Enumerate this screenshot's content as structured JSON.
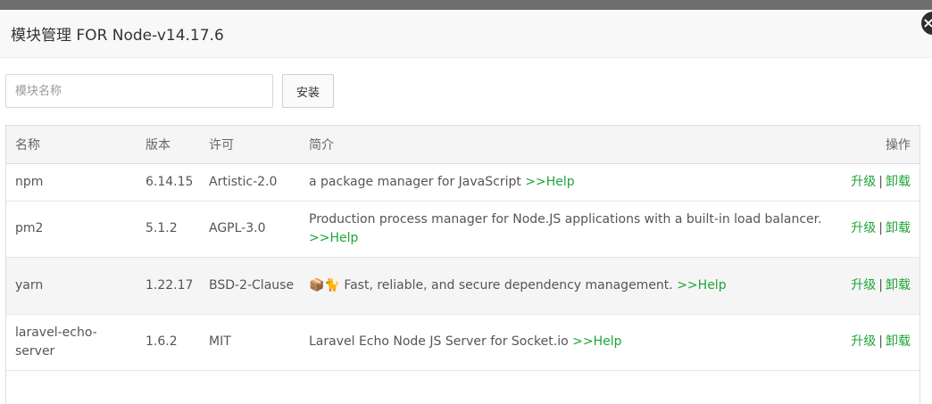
{
  "dialog": {
    "title": "模块管理 FOR Node-v14.17.6",
    "close_label": "×"
  },
  "toolbar": {
    "search_placeholder": "模块名称",
    "install_label": "安装"
  },
  "table": {
    "headers": [
      "名称",
      "版本",
      "许可",
      "简介",
      "操作"
    ],
    "rows": [
      {
        "name": "npm",
        "version": "6.14.15",
        "license": "Artistic-2.0",
        "desc": "a package manager for JavaScript",
        "help": ">>Help",
        "upgrade": "升级",
        "sep": "|",
        "uninstall": "卸载"
      },
      {
        "name": "pm2",
        "version": "5.1.2",
        "license": "AGPL-3.0",
        "desc": "Production process manager for Node.JS applications with a built-in load balancer.",
        "help": ">>Help",
        "upgrade": "升级",
        "sep": "|",
        "uninstall": "卸载"
      },
      {
        "name": "yarn",
        "version": "1.22.17",
        "license": "BSD-2-Clause",
        "desc": "📦🐈 Fast, reliable, and secure dependency management.",
        "help": ">>Help",
        "upgrade": "升级",
        "sep": "|",
        "uninstall": "卸载"
      },
      {
        "name": "laravel-echo-server",
        "version": "1.6.2",
        "license": "MIT",
        "desc": "Laravel Echo Node JS Server for Socket.io",
        "help": ">>Help",
        "upgrade": "升级",
        "sep": "|",
        "uninstall": "卸载"
      }
    ]
  }
}
